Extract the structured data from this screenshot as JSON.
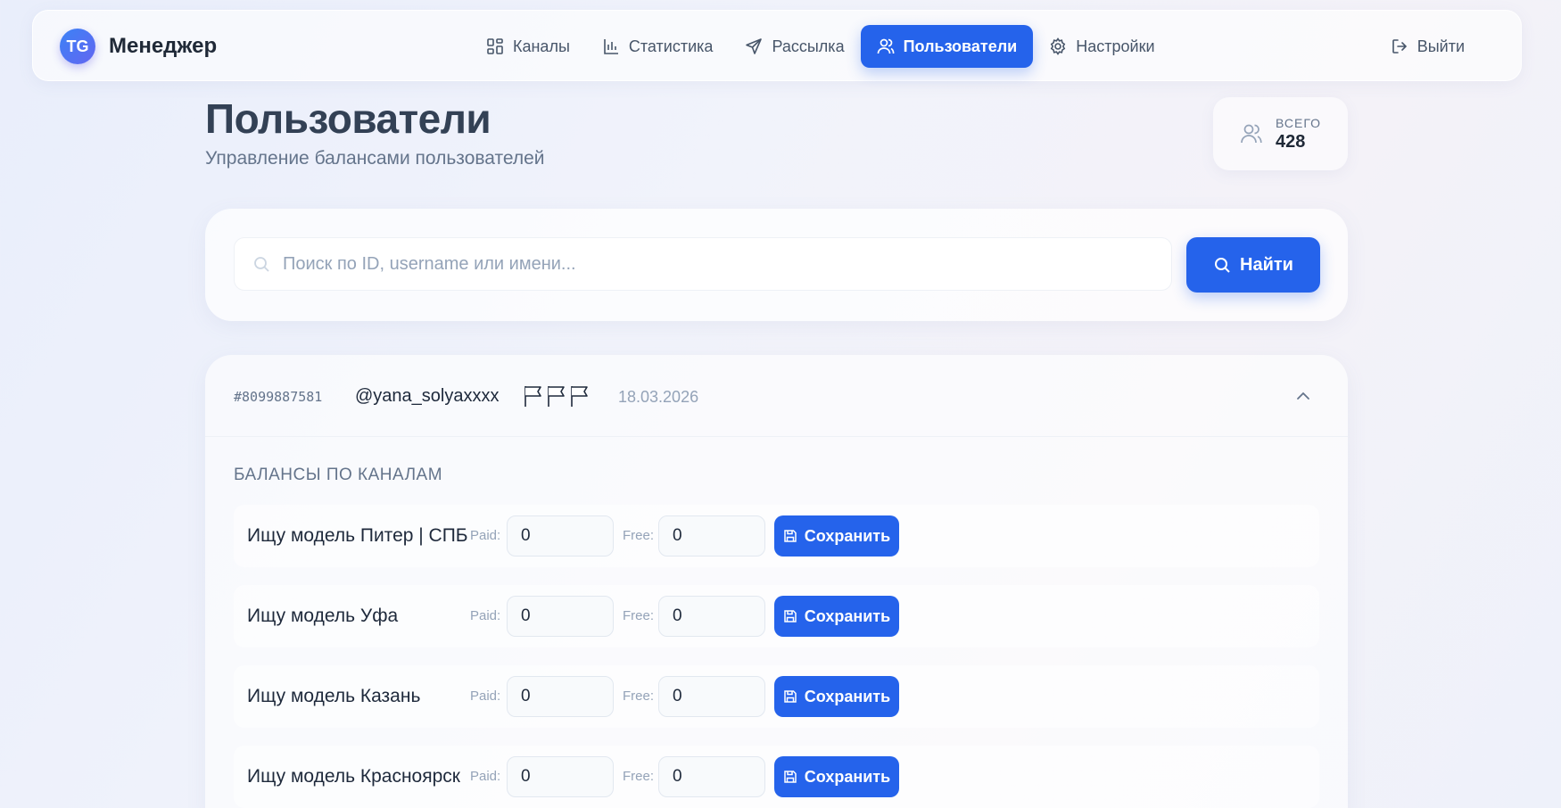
{
  "brand": {
    "logo_text": "TG",
    "name": "Менеджер"
  },
  "nav": {
    "items": [
      {
        "label": "Каналы",
        "icon": "grid-icon",
        "active": false
      },
      {
        "label": "Статистика",
        "icon": "bar-chart-icon",
        "active": false
      },
      {
        "label": "Рассылка",
        "icon": "send-icon",
        "active": false
      },
      {
        "label": "Пользователи",
        "icon": "users-icon",
        "active": true
      },
      {
        "label": "Настройки",
        "icon": "gear-icon",
        "active": false
      }
    ],
    "logout_label": "Выйти"
  },
  "header": {
    "title": "Пользователи",
    "subtitle": "Управление балансами пользователей"
  },
  "total": {
    "label": "ВСЕГО",
    "value": "428"
  },
  "search": {
    "placeholder": "Поиск по ID, username или имени...",
    "value": "",
    "button_label": "Найти"
  },
  "user": {
    "id": "#8099887581",
    "username": "@yana_solyaxxxx",
    "date": "18.03.2026",
    "flags_count": 3
  },
  "balances": {
    "section_title": "БАЛАНСЫ ПО КАНАЛАМ",
    "paid_label": "Paid:",
    "free_label": "Free:",
    "save_label": "Сохранить",
    "rows": [
      {
        "channel": "Ищу модель Питер | СПБ",
        "paid": "0",
        "free": "0"
      },
      {
        "channel": "Ищу модель Уфа",
        "paid": "0",
        "free": "0"
      },
      {
        "channel": "Ищу модель Казань",
        "paid": "0",
        "free": "0"
      },
      {
        "channel": "Ищу модель Красноярск",
        "paid": "0",
        "free": "0"
      }
    ]
  },
  "colors": {
    "accent": "#2563eb",
    "title": "#334155",
    "muted": "#64748b"
  }
}
